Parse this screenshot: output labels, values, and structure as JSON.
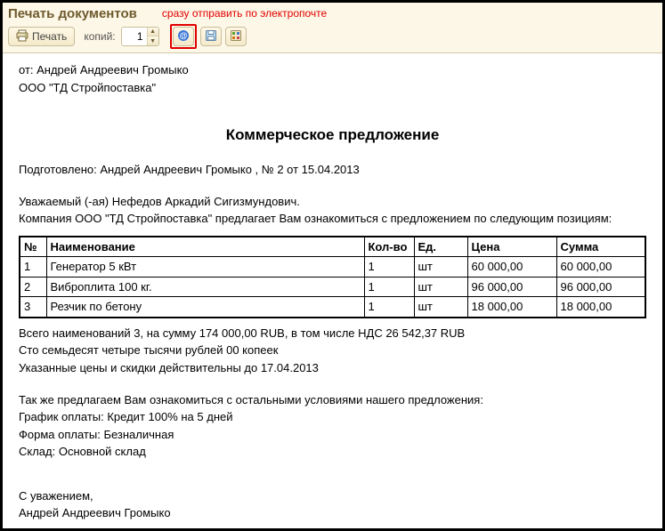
{
  "window": {
    "title": "Печать документов",
    "annotation": "сразу отправить по электропочте"
  },
  "toolbar": {
    "print_label": "Печать",
    "copies_label": "копий:",
    "copies_value": "1"
  },
  "doc": {
    "from_line": "от: Андрей Андреевич Громыко",
    "company_line": "ООО \"ТД Стройпоставка\"",
    "title": "Коммерческое предложение",
    "prepared": "Подготовлено: Андрей Андреевич Громыко , № 2 от 15.04.2013",
    "greeting": "Уважаемый (-ая) Нефедов Аркадий Сигизмундович.",
    "intro": "Компания ООО \"ТД Стройпоставка\" предлагает Вам ознакомиться с предложением по следующим позициям:",
    "totals1": "Всего наименований 3, на сумму 174 000,00 RUB, в том числе НДС 26 542,37 RUB",
    "totals2": "Сто семьдесят четыре тысячи рублей 00 копеек",
    "totals3": "Указанные цены и скидки действительны до 17.04.2013",
    "cond_intro": "Так же предлагаем Вам ознакомиться с остальными условиями нашего предложения:",
    "cond1": "График оплаты: Кредит 100% на 5 дней",
    "cond2": "Форма оплаты: Безналичная",
    "cond3": "Склад: Основной склад",
    "sign1": "С уважением,",
    "sign2": "Андрей Андреевич Громыко"
  },
  "table": {
    "headers": {
      "num": "№",
      "name": "Наименование",
      "qty": "Кол-во",
      "unit": "Ед.",
      "price": "Цена",
      "sum": "Сумма"
    },
    "rows": [
      {
        "num": "1",
        "name": "Генератор 5 кВт",
        "qty": "1",
        "unit": "шт",
        "price": "60 000,00",
        "sum": "60 000,00"
      },
      {
        "num": "2",
        "name": "Виброплита 100 кг.",
        "qty": "1",
        "unit": "шт",
        "price": "96 000,00",
        "sum": "96 000,00"
      },
      {
        "num": "3",
        "name": "Резчик по бетону",
        "qty": "1",
        "unit": "шт",
        "price": "18 000,00",
        "sum": "18 000,00"
      }
    ]
  }
}
